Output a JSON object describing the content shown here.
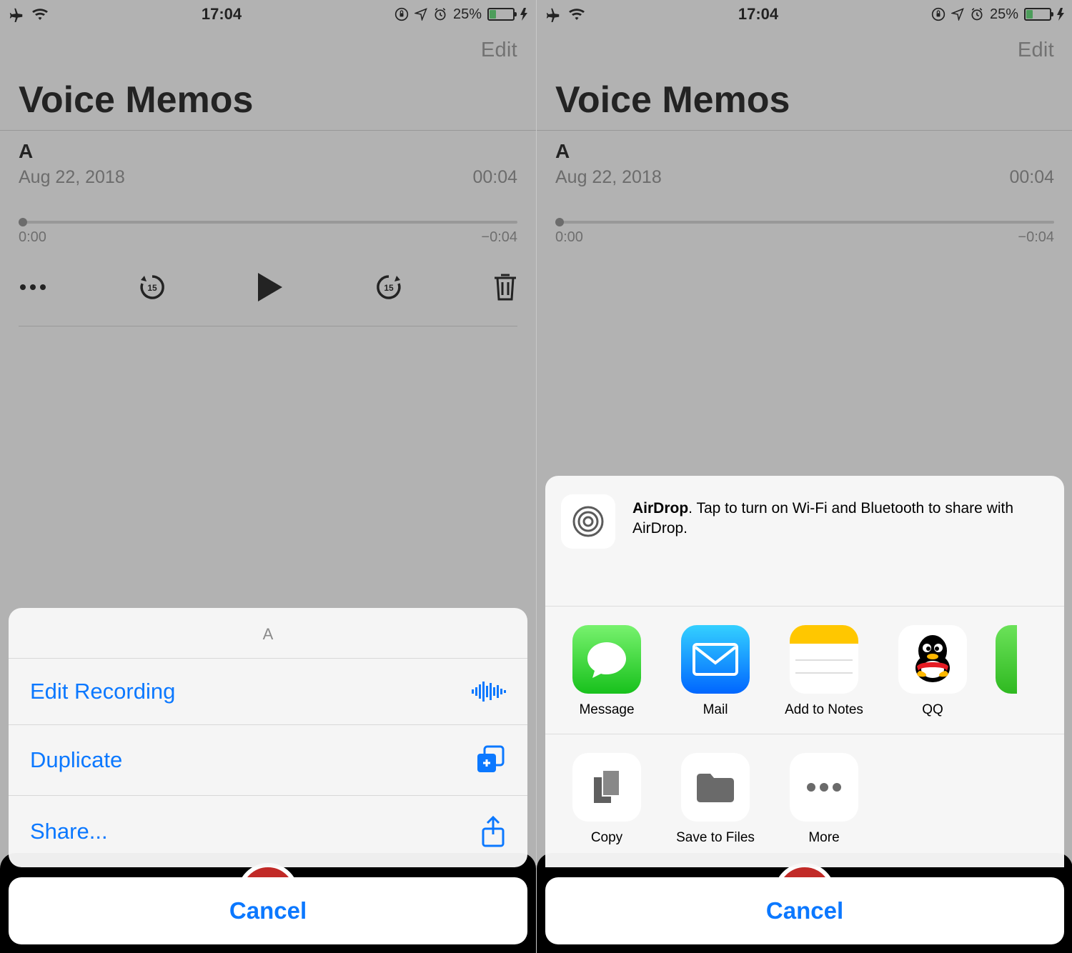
{
  "status": {
    "time": "17:04",
    "battery_pct": "25%"
  },
  "header": {
    "edit": "Edit"
  },
  "title": "Voice Memos",
  "memo": {
    "name": "A",
    "date": "Aug 22, 2018",
    "duration": "00:04",
    "t_start": "0:00",
    "t_end": "−0:04"
  },
  "actionSheet": {
    "title": "A",
    "options": [
      {
        "label": "Edit Recording",
        "icon": "waveform"
      },
      {
        "label": "Duplicate",
        "icon": "duplicate"
      },
      {
        "label": "Share...",
        "icon": "share"
      }
    ],
    "cancel": "Cancel"
  },
  "shareSheet": {
    "airdrop": {
      "bold": "AirDrop",
      "text": ". Tap to turn on Wi-Fi and Bluetooth to share with AirDrop."
    },
    "apps": [
      {
        "label": "Message",
        "icon": "message"
      },
      {
        "label": "Mail",
        "icon": "mail"
      },
      {
        "label": "Add to Notes",
        "icon": "notes"
      },
      {
        "label": "QQ",
        "icon": "qq"
      }
    ],
    "actions": [
      {
        "label": "Copy",
        "icon": "copy"
      },
      {
        "label": "Save to Files",
        "icon": "folder"
      },
      {
        "label": "More",
        "icon": "more"
      }
    ],
    "cancel": "Cancel"
  }
}
